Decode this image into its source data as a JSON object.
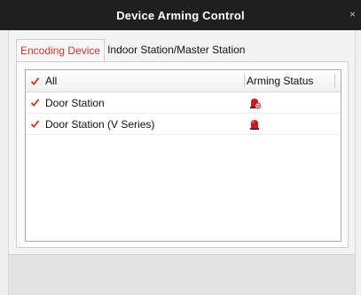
{
  "window": {
    "title": "Device Arming Control",
    "close_label": "×"
  },
  "tabs": [
    {
      "label": "Encoding Device",
      "active": true
    },
    {
      "label": "Indoor Station/Master Station",
      "active": false
    }
  ],
  "table": {
    "header": {
      "select_all_label": "All",
      "status_label": "Arming Status"
    },
    "rows": [
      {
        "name": "Door Station",
        "checked": true,
        "status_icon": "alarm-siren-disarmed-icon"
      },
      {
        "name": "Door Station (V Series)",
        "checked": true,
        "status_icon": "alarm-siren-icon"
      }
    ]
  },
  "colors": {
    "accent": "#d0342c",
    "titlebar": "#1f1f1f"
  }
}
